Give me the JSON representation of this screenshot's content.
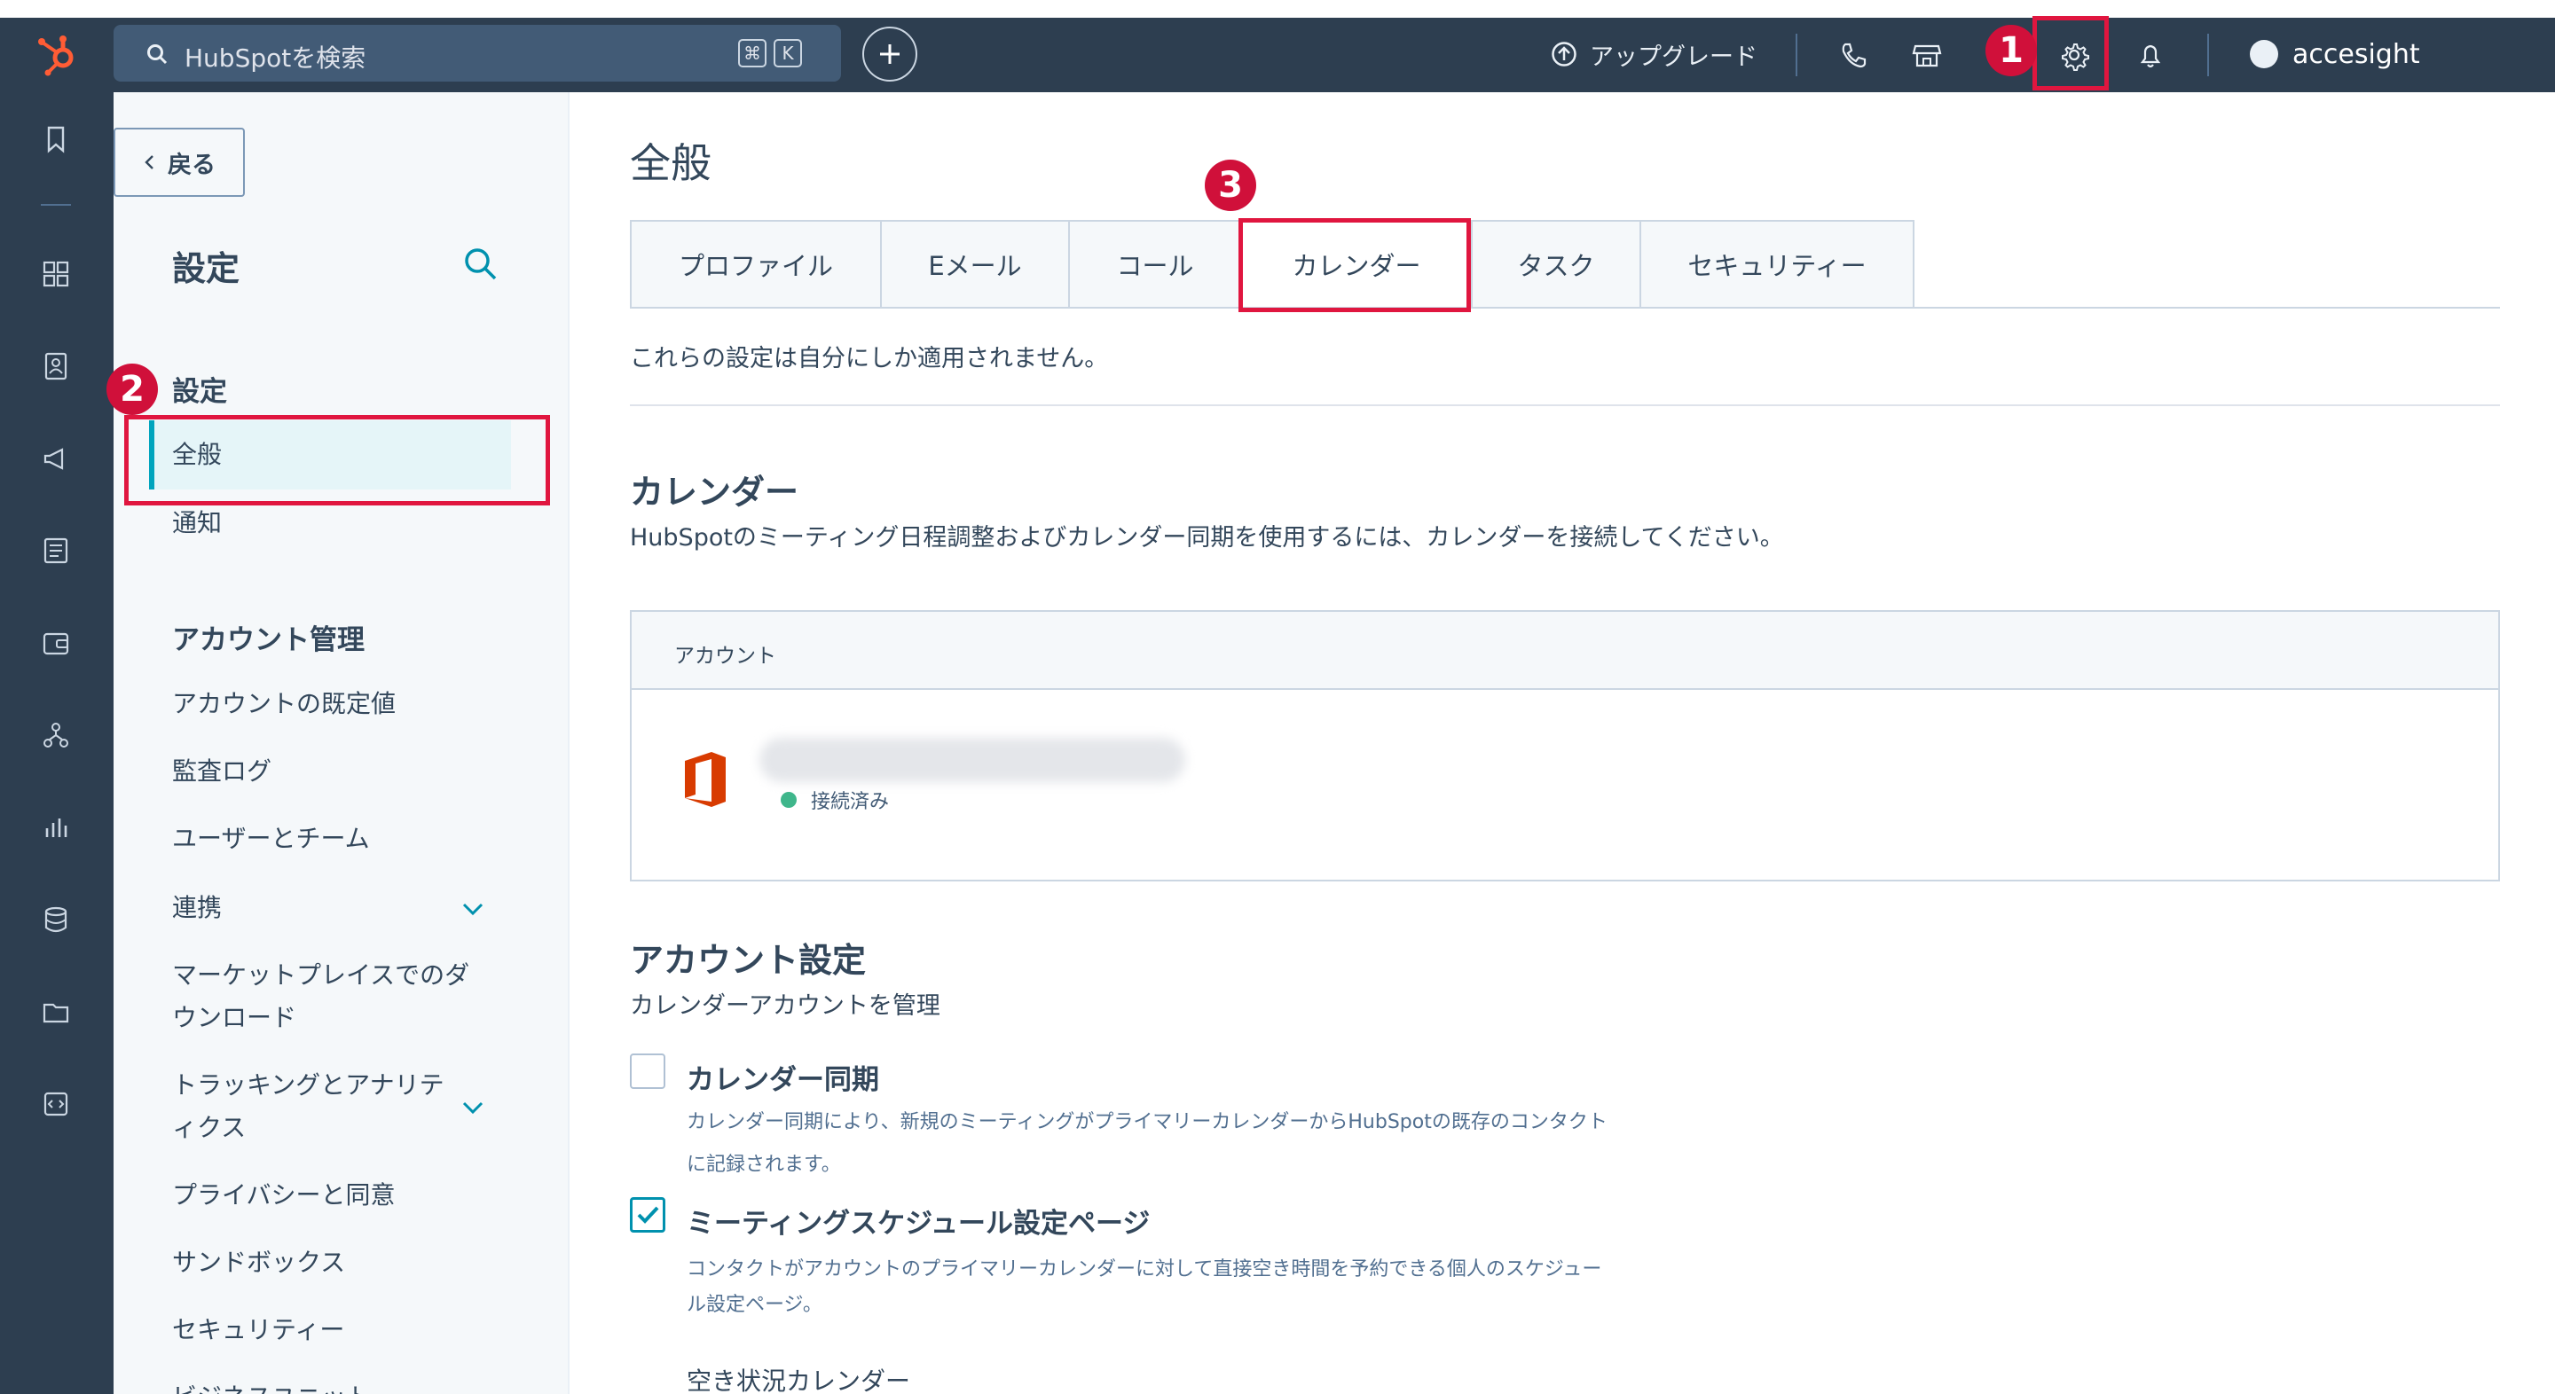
{
  "topnav": {
    "search_placeholder": "HubSpotを検索",
    "kbd_cmd": "⌘",
    "kbd_k": "K",
    "upgrade_label": "アップグレード",
    "user_name": "accesight"
  },
  "annotations": {
    "one": "1",
    "two": "2",
    "three": "3"
  },
  "sidebar": {
    "back_label": "戻る",
    "title": "設定",
    "section_settings": "設定",
    "items_settings": [
      "全般",
      "通知"
    ],
    "section_account": "アカウント管理",
    "items_account": [
      "アカウントの既定値",
      "監査ログ",
      "ユーザーとチーム",
      "連携",
      "マーケットプレイスでのダ",
      "ウンロード",
      "トラッキングとアナリテ",
      "ィクス",
      "プライバシーと同意",
      "サンドボックス",
      "セキュリティー",
      "ビジネスユニット"
    ]
  },
  "main": {
    "page_title": "全般",
    "tabs": [
      "プロファイル",
      "Eメール",
      "コール",
      "カレンダー",
      "タスク",
      "セキュリティー"
    ],
    "active_tab": "カレンダー",
    "note": "これらの設定は自分にしか適用されません。",
    "calendar_heading": "カレンダー",
    "calendar_desc": "HubSpotのミーティング日程調整およびカレンダー同期を使用するには、カレンダーを接続してください。",
    "account_col": "アカウント",
    "status": "接続済み",
    "account_settings_heading": "アカウント設定",
    "account_settings_desc": "カレンダーアカウントを管理",
    "sync": {
      "label": "カレンダー同期",
      "checked": false,
      "desc1": "カレンダー同期により、新規のミーティングがプライマリーカレンダーからHubSpotの既存のコンタクト",
      "desc2": "に記録されます。"
    },
    "meeting_page": {
      "label": "ミーティングスケジュール設定ページ",
      "checked": true,
      "desc1": "コンタクトがアカウントのプライマリーカレンダーに対して直接空き時間を予約できる個人のスケジュー",
      "desc2": "ル設定ページ。"
    },
    "availability": "空き状況カレンダー"
  },
  "colors": {
    "nav_bg": "#2d3e50",
    "accent": "#00a4bd",
    "highlight": "#e0163f",
    "status_green": "#3fb68b",
    "brand_orange": "#ff5c35"
  }
}
